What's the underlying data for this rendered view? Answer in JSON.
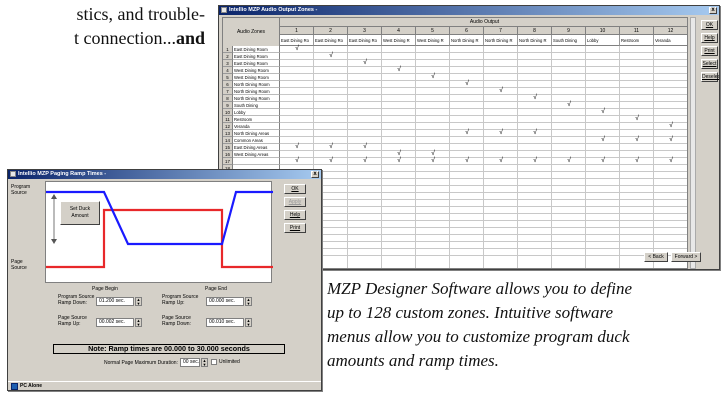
{
  "copy": {
    "line1": "stics, and trouble-",
    "line2_text": "t connection...",
    "line2_bold": "and"
  },
  "caption": {
    "line1": "MZP Designer Software allows you to define",
    "line2": "up to 128 custom zones. Intuitive software",
    "line3": "menus allow you to customize program duck",
    "line4": "amounts and ramp times."
  },
  "audio_window": {
    "title": "Intellio MZP Audio Output Zones -",
    "close": "x",
    "zones_header": "Audio Zones",
    "outputs_header": "Audio Output",
    "columns": [
      {
        "num": "1",
        "name": "East Dining Ro"
      },
      {
        "num": "2",
        "name": "East Dining Ro"
      },
      {
        "num": "3",
        "name": "East Dining Ro"
      },
      {
        "num": "4",
        "name": "West Dining R"
      },
      {
        "num": "5",
        "name": "West Dining R"
      },
      {
        "num": "6",
        "name": "North Dining R"
      },
      {
        "num": "7",
        "name": "North Dining R"
      },
      {
        "num": "8",
        "name": "North Dining R"
      },
      {
        "num": "9",
        "name": "South Dining"
      },
      {
        "num": "10",
        "name": "Lobby"
      },
      {
        "num": "11",
        "name": "Restroom"
      },
      {
        "num": "12",
        "name": "Veranda"
      }
    ],
    "rows": [
      {
        "num": "1",
        "name": "East Dining Room"
      },
      {
        "num": "2",
        "name": "East Dining Room"
      },
      {
        "num": "3",
        "name": "East Dining Room"
      },
      {
        "num": "4",
        "name": "West Dining Room"
      },
      {
        "num": "5",
        "name": "West Dining Room"
      },
      {
        "num": "6",
        "name": "North Dining Room"
      },
      {
        "num": "7",
        "name": "North Dining Room"
      },
      {
        "num": "8",
        "name": "North Dining Room"
      },
      {
        "num": "9",
        "name": "South Dining"
      },
      {
        "num": "10",
        "name": "Lobby"
      },
      {
        "num": "11",
        "name": "Restroom"
      },
      {
        "num": "12",
        "name": "Veranda"
      },
      {
        "num": "13",
        "name": "North Dining Areas"
      },
      {
        "num": "14",
        "name": "Common Areas"
      },
      {
        "num": "15",
        "name": "East Dining Areas"
      },
      {
        "num": "16",
        "name": "West Dining Areas"
      },
      {
        "num": "17",
        "name": ""
      },
      {
        "num": "18",
        "name": ""
      },
      {
        "num": "19",
        "name": ""
      },
      {
        "num": "20",
        "name": ""
      },
      {
        "num": "21",
        "name": ""
      },
      {
        "num": "22",
        "name": ""
      },
      {
        "num": "23",
        "name": ""
      },
      {
        "num": "24",
        "name": ""
      },
      {
        "num": "25",
        "name": ""
      },
      {
        "num": "26",
        "name": ""
      },
      {
        "num": "27",
        "name": ""
      },
      {
        "num": "28",
        "name": ""
      },
      {
        "num": "29",
        "name": ""
      },
      {
        "num": "30",
        "name": ""
      }
    ],
    "checks": [
      [
        1,
        1
      ],
      [
        2,
        2
      ],
      [
        3,
        3
      ],
      [
        4,
        4
      ],
      [
        5,
        5
      ],
      [
        6,
        6
      ],
      [
        7,
        7
      ],
      [
        8,
        8
      ],
      [
        9,
        9
      ],
      [
        10,
        10
      ],
      [
        11,
        11
      ],
      [
        12,
        12
      ],
      [
        13,
        6
      ],
      [
        13,
        7
      ],
      [
        13,
        8
      ],
      [
        14,
        10
      ],
      [
        14,
        11
      ],
      [
        14,
        12
      ],
      [
        15,
        1
      ],
      [
        15,
        2
      ],
      [
        15,
        3
      ],
      [
        16,
        4
      ],
      [
        16,
        5
      ],
      [
        17,
        1
      ],
      [
        17,
        2
      ],
      [
        17,
        3
      ],
      [
        17,
        4
      ],
      [
        17,
        5
      ],
      [
        17,
        6
      ],
      [
        17,
        7
      ],
      [
        17,
        8
      ],
      [
        17,
        9
      ],
      [
        17,
        10
      ],
      [
        17,
        11
      ],
      [
        17,
        12
      ]
    ],
    "check_glyph": "√",
    "buttons": {
      "ok": "OK",
      "help": "Help",
      "print": "Print",
      "select": "Select",
      "deselect": "Deselect",
      "back": "< Back",
      "forward": "Forward >"
    }
  },
  "ramp_window": {
    "title": "Intellio MZP Paging Ramp Times -",
    "close": "x",
    "program_source_label": "Program Source",
    "page_source_label": "Page Source",
    "set_duck_label": "Set Duck Amount",
    "page_begin": "Page Begin",
    "page_end": "Page End",
    "buttons": {
      "ok": "OK",
      "apply": "Apply",
      "help": "Help",
      "print": "Print"
    },
    "fields": {
      "prog_ramp_down_label": "Program Source Ramp Down:",
      "prog_ramp_down_value": "01.200 sec.",
      "prog_ramp_up_label": "Program Source Ramp Up:",
      "prog_ramp_up_value": "00.000 sec.",
      "page_ramp_up_label": "Page Source Ramp Up:",
      "page_ramp_up_value": "00.002 sec.",
      "page_ramp_down_label": "Page Source Ramp Down:",
      "page_ramp_down_value": "00.010 sec."
    },
    "note": "Note: Ramp times are 00.000 to 30.000 seconds",
    "max_duration_label": "Normal Page Maximum Duration:",
    "max_duration_value": "00 sec.",
    "unlimited_label": "Unlimited",
    "status": "PC Alone"
  },
  "colors": {
    "program_line": "#1a1aff",
    "page_line": "#e8282a",
    "title_start": "#0a246a",
    "title_end": "#a6caf0"
  }
}
